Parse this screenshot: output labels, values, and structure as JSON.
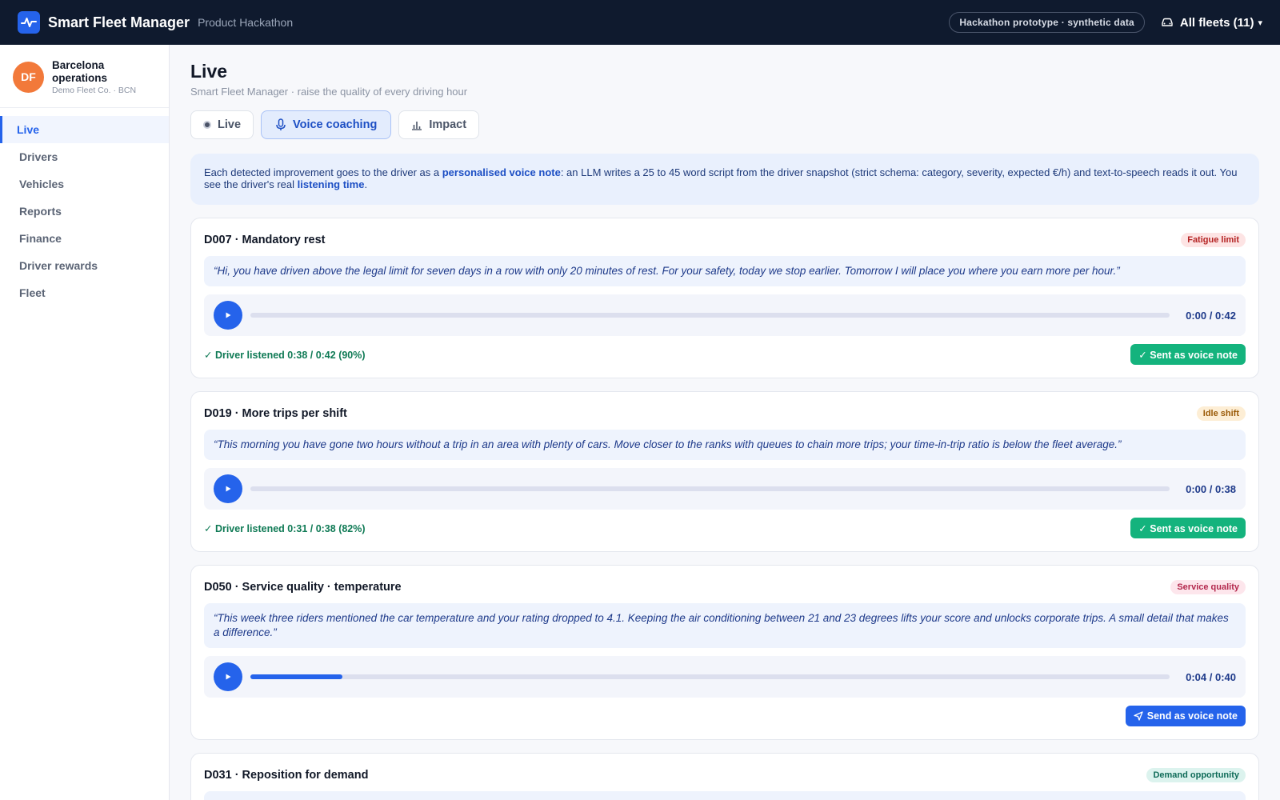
{
  "header": {
    "brand": "Smart Fleet Manager",
    "subtitle": "Product Hackathon",
    "prototype_pill": "Hackathon prototype · synthetic data",
    "fleet_selector": "All fleets (11)",
    "fleet_caret": "▾"
  },
  "org": {
    "initials": "DF",
    "name": "Barcelona operations",
    "sub": "Demo Fleet Co. · BCN",
    "avatar_color": "#f2793a"
  },
  "nav": [
    {
      "label": "Live",
      "active": true
    },
    {
      "label": "Drivers"
    },
    {
      "label": "Vehicles"
    },
    {
      "label": "Reports"
    },
    {
      "label": "Finance"
    },
    {
      "label": "Driver rewards"
    },
    {
      "label": "Fleet"
    }
  ],
  "page": {
    "title": "Live",
    "subtitle": "Smart Fleet Manager · raise the quality of every driving hour"
  },
  "tabs": [
    {
      "label": "Live",
      "icon": "status-dot-icon"
    },
    {
      "label": "Voice coaching",
      "icon": "microphone-icon",
      "active": true
    },
    {
      "label": "Impact",
      "icon": "bar-chart-icon"
    }
  ],
  "info": {
    "part1": "Each detected improvement goes to the driver as a ",
    "bold1": "personalised voice note",
    "part2": ": an LLM writes a 25 to 45 word script from the driver snapshot (strict schema: category, severity, expected €/h) and text-to-speech reads it out. You see the driver's real ",
    "bold2": "listening time",
    "part3": "."
  },
  "cards": [
    {
      "title": "D007 · Mandatory rest",
      "badge": "Fatigue limit",
      "badge_bg": "#fde4e4",
      "badge_fg": "#b42323",
      "quote": "“Hi, you have driven above the legal limit for seven days in a row with only 20 minutes of rest. For your safety, today we stop earlier. Tomorrow I will place you where you earn more per hour.”",
      "time": "0:00 / 0:42",
      "progress": 0,
      "listened": "✓ Driver listened 0:38 / 0:42 (90%)",
      "button": "✓ Sent as voice note",
      "sent": true
    },
    {
      "title": "D019 · More trips per shift",
      "badge": "Idle shift",
      "badge_bg": "#fdeed5",
      "badge_fg": "#9a5a07",
      "quote": "“This morning you have gone two hours without a trip in an area with plenty of cars. Move closer to the ranks with queues to chain more trips; your time-in-trip ratio is below the fleet average.”",
      "time": "0:00 / 0:38",
      "progress": 0,
      "listened": "✓ Driver listened 0:31 / 0:38 (82%)",
      "button": "✓ Sent as voice note",
      "sent": true
    },
    {
      "title": "D050 · Service quality · temperature",
      "badge": "Service quality",
      "badge_bg": "#fde6ec",
      "badge_fg": "#b3284d",
      "quote": "“This week three riders mentioned the car temperature and your rating dropped to 4.1. Keeping the air conditioning between 21 and 23 degrees lifts your score and unlocks corporate trips. A small detail that makes a difference.”",
      "time": "0:04 / 0:40",
      "progress": 0.1,
      "listened": "",
      "button": "Send as voice note",
      "sent": false
    },
    {
      "title": "D031 · Reposition for demand",
      "badge": "Demand opportunity",
      "badge_bg": "#dcf3ee",
      "badge_fg": "#0f6b58",
      "quote": "",
      "time": "",
      "progress": 0,
      "listened": "",
      "button": "",
      "sent": false
    }
  ]
}
